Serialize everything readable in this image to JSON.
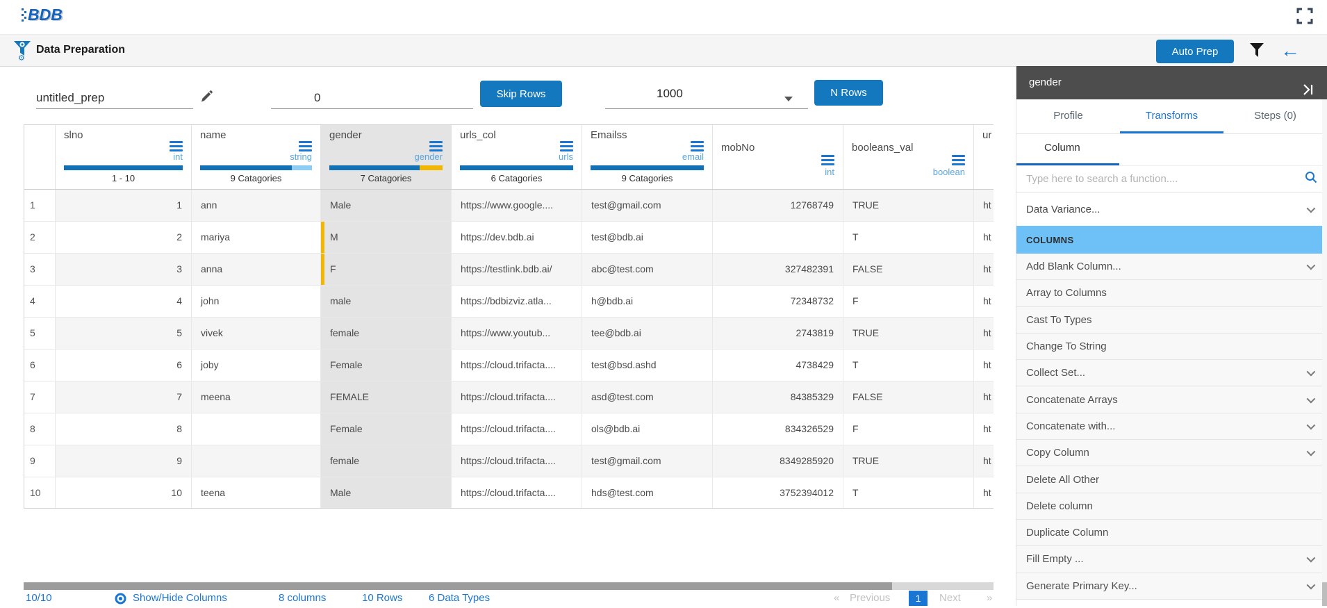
{
  "app": {
    "logo_text": "BDB"
  },
  "toolbar": {
    "title": "Data Preparation",
    "auto_prep_label": "Auto Prep"
  },
  "controls": {
    "name_value": "untitled_prep",
    "skip_value": "0",
    "skip_button": "Skip Rows",
    "nrows_value": "1000",
    "nrows_button": "N Rows"
  },
  "colors": {
    "primary_blue": "#1478be",
    "link_blue": "#1976d2",
    "bar_blue": "#1271b5",
    "bar_light_blue": "#8ecdf3",
    "bar_yellow": "#f2b705",
    "selected_column_gray": "#e4e4e4",
    "panel_header_gray": "#4d4d4d",
    "columns_section_bg": "#6ec1f7"
  },
  "table": {
    "columns": [
      {
        "label": ""
      },
      {
        "label": "slno",
        "type": "int",
        "stat": "1 - 10",
        "bar": {
          "blue": 100,
          "light": 0,
          "yellow": 0
        }
      },
      {
        "label": "name",
        "type": "string",
        "stat": "9 Catagories",
        "bar": {
          "blue": 82,
          "light": 18,
          "yellow": 0
        }
      },
      {
        "label": "gender",
        "type": "gender",
        "stat": "7 Catagories",
        "selected": true,
        "bar": {
          "blue": 80,
          "light": 0,
          "yellow": 20
        }
      },
      {
        "label": "urls_col",
        "type": "urls",
        "stat": "6 Catagories",
        "bar": {
          "blue": 100,
          "light": 0,
          "yellow": 0
        }
      },
      {
        "label": "Emailss",
        "type": "email",
        "stat": "9 Catagories",
        "bar": {
          "blue": 100,
          "light": 0,
          "yellow": 0
        }
      },
      {
        "label": "mobNo",
        "type": "int"
      },
      {
        "label": "booleans_val",
        "type": "boolean"
      },
      {
        "label": "ur",
        "truncated": true
      }
    ],
    "rows": [
      {
        "num": "1",
        "slno": "1",
        "name": "ann",
        "gender": "Male",
        "gender_flag": false,
        "url": "https://www.google....",
        "email": "test@gmail.com",
        "mob": "12768749",
        "bool": "TRUE",
        "extra": "ht"
      },
      {
        "num": "2",
        "slno": "2",
        "name": "mariya",
        "gender": "M",
        "gender_flag": true,
        "url": "https://dev.bdb.ai",
        "email": "test@bdb.ai",
        "mob": "",
        "bool": "T",
        "extra": "ht"
      },
      {
        "num": "3",
        "slno": "3",
        "name": "anna",
        "gender": "F",
        "gender_flag": true,
        "url": "https://testlink.bdb.ai/",
        "email": "abc@test.com",
        "mob": "327482391",
        "bool": "FALSE",
        "extra": "ht"
      },
      {
        "num": "4",
        "slno": "4",
        "name": "john",
        "gender": "male",
        "gender_flag": false,
        "url": "https://bdbizviz.atla...",
        "email": "h@bdb.ai",
        "mob": "72348732",
        "bool": "F",
        "extra": "ht"
      },
      {
        "num": "5",
        "slno": "5",
        "name": "vivek",
        "gender": "female",
        "gender_flag": false,
        "url": "https://www.youtub...",
        "email": "tee@bdb.ai",
        "mob": "2743819",
        "bool": "TRUE",
        "extra": "ht"
      },
      {
        "num": "6",
        "slno": "6",
        "name": "joby",
        "gender": "Female",
        "gender_flag": false,
        "url": "https://cloud.trifacta....",
        "email": "test@bsd.ashd",
        "mob": "4738429",
        "bool": "T",
        "extra": "ht"
      },
      {
        "num": "7",
        "slno": "7",
        "name": "meena",
        "gender": "FEMALE",
        "gender_flag": false,
        "url": "https://cloud.trifacta....",
        "email": "asd@test.com",
        "mob": "84385329",
        "bool": "FALSE",
        "extra": "ht"
      },
      {
        "num": "8",
        "slno": "8",
        "name": "",
        "gender": "Female",
        "gender_flag": false,
        "url": "https://cloud.trifacta....",
        "email": "ols@bdb.ai",
        "mob": "834326529",
        "bool": "F",
        "extra": "ht"
      },
      {
        "num": "9",
        "slno": "9",
        "name": "",
        "gender": "female",
        "gender_flag": false,
        "url": "https://cloud.trifacta....",
        "email": "test@gmail.com",
        "mob": "8349285920",
        "bool": "TRUE",
        "extra": "ht"
      },
      {
        "num": "10",
        "slno": "10",
        "name": "teena",
        "gender": "Male",
        "gender_flag": false,
        "url": "https://cloud.trifacta....",
        "email": "hds@test.com",
        "mob": "3752394012",
        "bool": "T",
        "extra": "ht"
      }
    ]
  },
  "footer": {
    "count": "10/10",
    "show_hide": "Show/Hide Columns",
    "columns_summary": "8 columns",
    "rows_summary": "10 Rows",
    "types_summary": "6 Data Types",
    "laquo": "«",
    "prev": "Previous",
    "page": "1",
    "next": "Next",
    "raquo": "»"
  },
  "panel": {
    "title": "gender",
    "tabs": [
      {
        "label": "Profile",
        "active": false
      },
      {
        "label": "Transforms",
        "active": true
      },
      {
        "label": "Steps (0)",
        "active": false
      }
    ],
    "subtab": "Column",
    "search_placeholder": "Type here to search a function....",
    "variance": {
      "label": "Data Variance...",
      "chevron": true
    },
    "section": "COLUMNS",
    "items": [
      {
        "label": "Add Blank Column...",
        "chevron": true
      },
      {
        "label": "Array to Columns",
        "chevron": false
      },
      {
        "label": "Cast To Types",
        "chevron": false
      },
      {
        "label": "Change To String",
        "chevron": false
      },
      {
        "label": "Collect Set...",
        "chevron": true
      },
      {
        "label": "Concatenate Arrays",
        "chevron": true
      },
      {
        "label": "Concatenate with...",
        "chevron": true
      },
      {
        "label": "Copy Column",
        "chevron": true
      },
      {
        "label": "Delete All Other",
        "chevron": false
      },
      {
        "label": "Delete column",
        "chevron": false
      },
      {
        "label": "Duplicate Column",
        "chevron": false
      },
      {
        "label": "Fill Empty ...",
        "chevron": true
      },
      {
        "label": "Generate Primary Key...",
        "chevron": true
      }
    ]
  }
}
